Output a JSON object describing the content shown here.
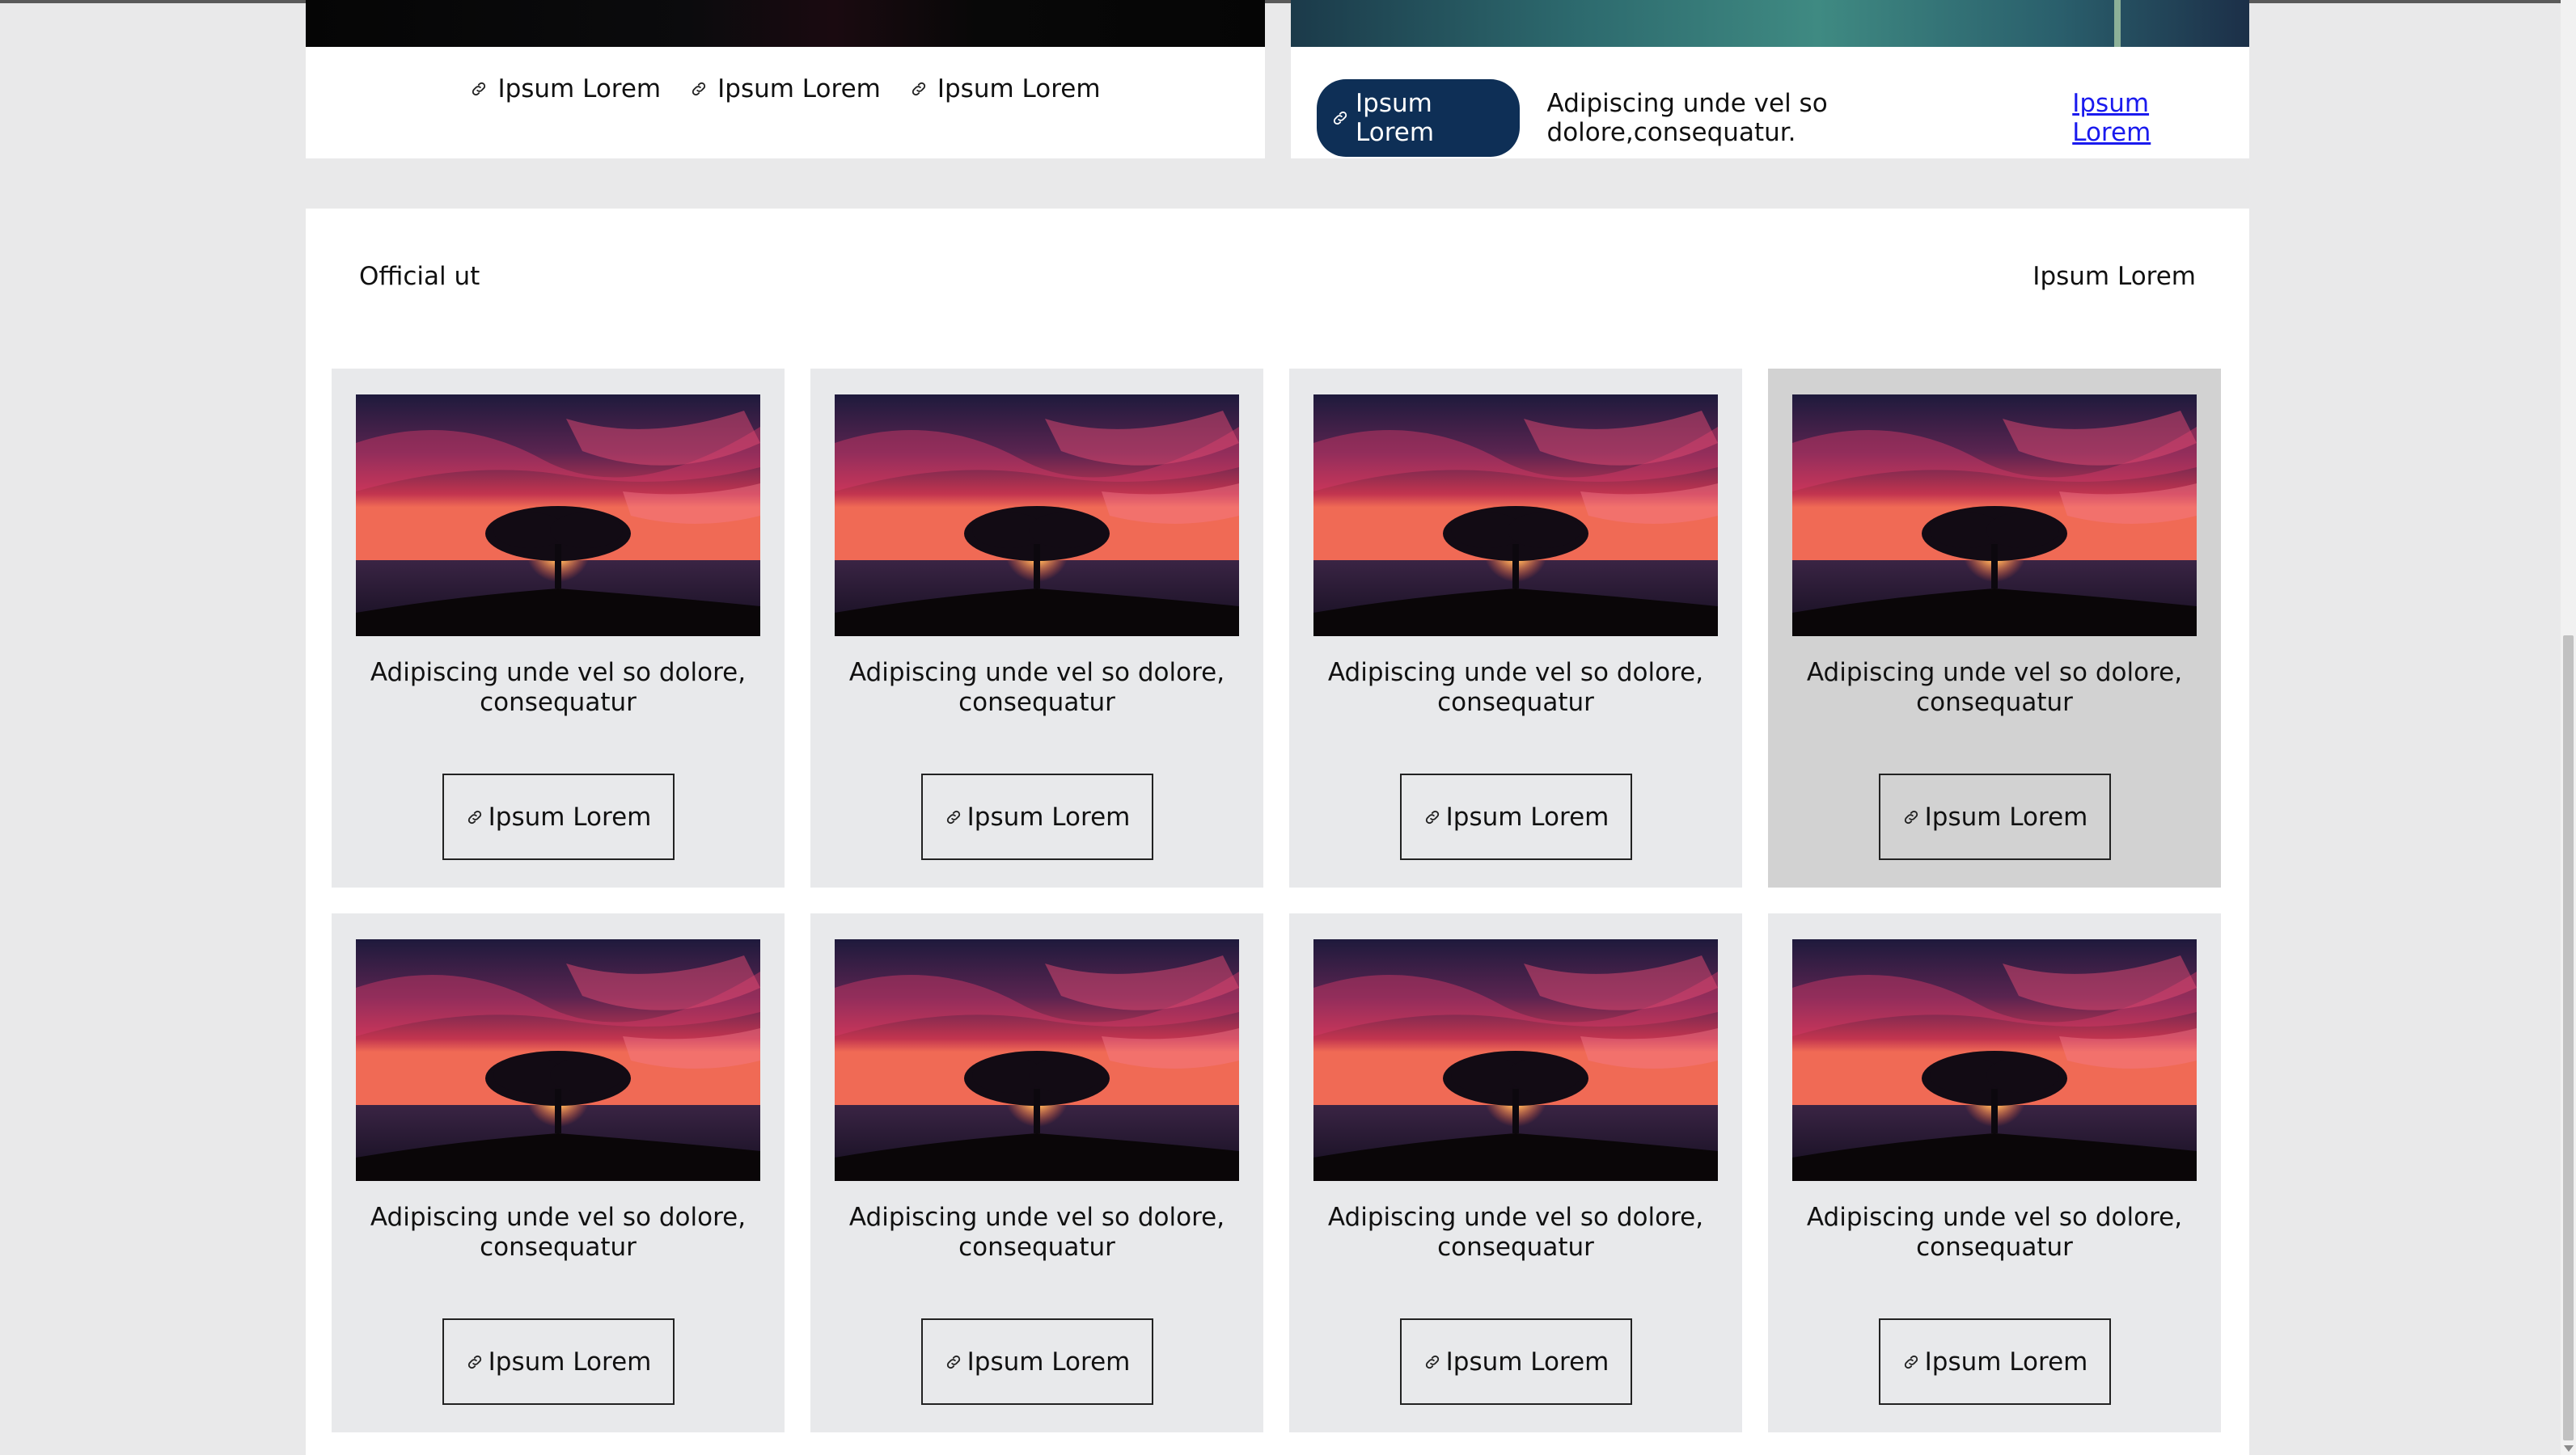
{
  "top_left": {
    "links": [
      "Ipsum Lorem",
      "Ipsum Lorem",
      "Ipsum Lorem"
    ]
  },
  "top_right": {
    "pill_label": "Ipsum Lorem",
    "text": "Adipiscing unde vel so dolore,consequatur.",
    "link_label": "Ipsum Lorem"
  },
  "section": {
    "title": "Official ut",
    "action_label": "Ipsum Lorem"
  },
  "cards": [
    {
      "text": "Adipiscing unde vel so dolore, consequatur",
      "button": "Ipsum Lorem"
    },
    {
      "text": "Adipiscing unde vel so dolore, consequatur",
      "button": "Ipsum Lorem"
    },
    {
      "text": "Adipiscing unde vel so dolore, consequatur",
      "button": "Ipsum Lorem"
    },
    {
      "text": "Adipiscing unde vel so dolore, consequatur",
      "button": "Ipsum Lorem"
    },
    {
      "text": "Adipiscing unde vel so dolore, consequatur",
      "button": "Ipsum Lorem"
    },
    {
      "text": "Adipiscing unde vel so dolore, consequatur",
      "button": "Ipsum Lorem"
    },
    {
      "text": "Adipiscing unde vel so dolore, consequatur",
      "button": "Ipsum Lorem"
    },
    {
      "text": "Adipiscing unde vel so dolore, consequatur",
      "button": "Ipsum Lorem"
    }
  ],
  "colors": {
    "page_bg": "#e9e9ea",
    "card_bg": "#e8e9eb",
    "card_hover_bg": "#d2d2d2",
    "pill_bg": "#0e2f56",
    "link_color": "#1a1aee"
  },
  "icons": {
    "link": "link-icon"
  }
}
